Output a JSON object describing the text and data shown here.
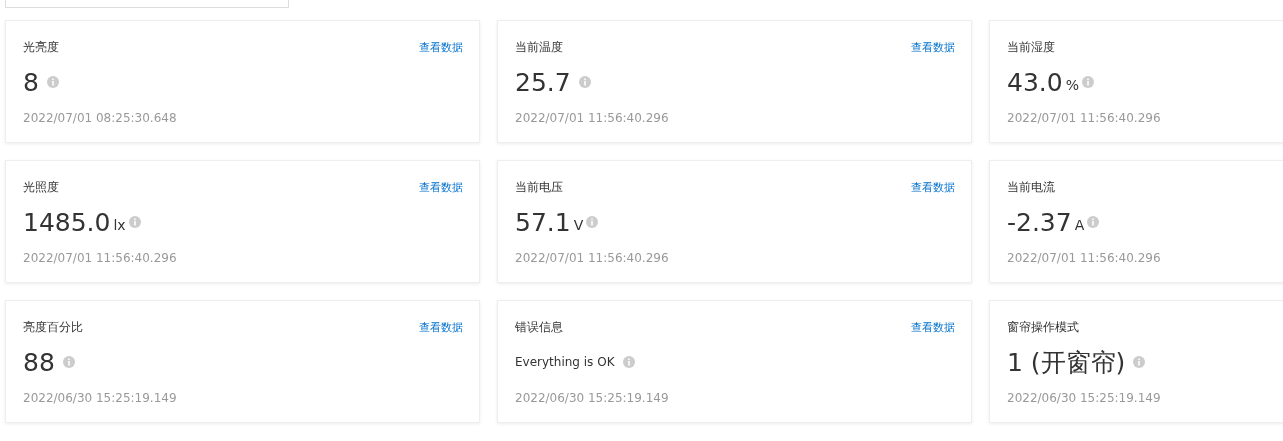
{
  "cards": [
    {
      "title": "光亮度",
      "link": "查看数据",
      "kind": "number",
      "value": "8",
      "timestamp": "2022/07/01 08:25:30.648"
    },
    {
      "title": "当前温度",
      "link": "查看数据",
      "kind": "number",
      "value": "25.7",
      "timestamp": "2022/07/01 11:56:40.296"
    },
    {
      "title": "当前湿度",
      "kind": "number",
      "value": "43.0",
      "unit": "%",
      "timestamp": "2022/07/01 11:56:40.296"
    },
    {
      "title": "光照度",
      "link": "查看数据",
      "kind": "number",
      "value": "1485.0",
      "unit": "lx",
      "timestamp": "2022/07/01 11:56:40.296"
    },
    {
      "title": "当前电压",
      "link": "查看数据",
      "kind": "number",
      "value": "57.1",
      "unit": "V",
      "timestamp": "2022/07/01 11:56:40.296"
    },
    {
      "title": "当前电流",
      "kind": "number",
      "value": "-2.37",
      "unit": "A",
      "timestamp": "2022/07/01 11:56:40.296"
    },
    {
      "title": "亮度百分比",
      "link": "查看数据",
      "kind": "number",
      "value": "88",
      "timestamp": "2022/06/30 15:25:19.149"
    },
    {
      "title": "错误信息",
      "link": "查看数据",
      "kind": "text",
      "value": "Everything is OK",
      "timestamp": "2022/06/30 15:25:19.149"
    },
    {
      "title": "窗帘操作模式",
      "kind": "number",
      "value": "1 (开窗帘)",
      "timestamp": "2022/06/30 15:25:19.149"
    }
  ]
}
